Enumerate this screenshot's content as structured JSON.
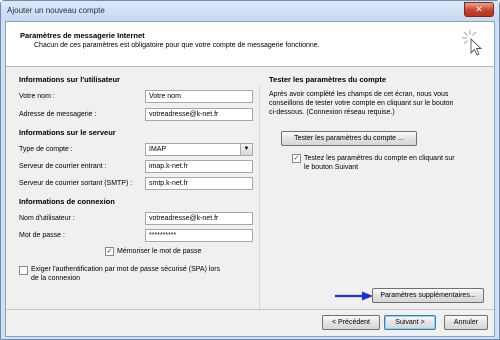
{
  "window": {
    "title": "Ajouter un nouveau compte",
    "close_glyph": "✕"
  },
  "header": {
    "title": "Paramètres de messagerie Internet",
    "subtitle": "Chacun de ces paramètres est obligatoire pour que votre compte de messagerie fonctionne.",
    "icon": "cursor-sparkle-icon"
  },
  "user_info": {
    "heading": "Informations sur l'utilisateur",
    "name_label": "Votre nom :",
    "name_value": "Votre nom",
    "email_label": "Adresse de messagerie :",
    "email_value": "votreadresse@k-net.fr"
  },
  "server_info": {
    "heading": "Informations sur le serveur",
    "type_label": "Type de compte :",
    "type_value": "IMAP",
    "incoming_label": "Serveur de courrier entrant :",
    "incoming_value": "imap.k-net.fr",
    "outgoing_label": "Serveur de courrier sortant (SMTP) :",
    "outgoing_value": "smtp.k-net.fr"
  },
  "login_info": {
    "heading": "Informations de connexion",
    "username_label": "Nom d'utilisateur :",
    "username_value": "votreadresse@k-net.fr",
    "password_label": "Mot de passe :",
    "password_value": "**********",
    "remember_label": "Mémoriser le mot de passe",
    "remember_checked": true,
    "spa_label_1": "Exiger l'authentification par mot de passe sécurisé (SPA) lors",
    "spa_label_2": "de la connexion",
    "spa_checked": false
  },
  "test": {
    "heading": "Tester les paramètres du compte",
    "desc_1": "Après avoir complété les champs de cet écran, nous vous",
    "desc_2": "conseillons de tester votre compte en cliquant sur le bouton",
    "desc_3": "ci-dessous. (Connexion réseau requise.)",
    "test_button": "Tester les paramètres du compte ...",
    "auto_test_1": "Testez les paramètres du compte en cliquant sur",
    "auto_test_2": "le bouton Suivant",
    "auto_test_checked": true
  },
  "more_button": "Paramètres supplémentaires...",
  "nav": {
    "back": "< Précédent",
    "next": "Suivant >",
    "cancel": "Annuler"
  },
  "colors": {
    "arrow": "#1b2fd6",
    "accent": "#3c7fb1"
  },
  "check_glyph": "✓",
  "select_arrow_glyph": "▼"
}
